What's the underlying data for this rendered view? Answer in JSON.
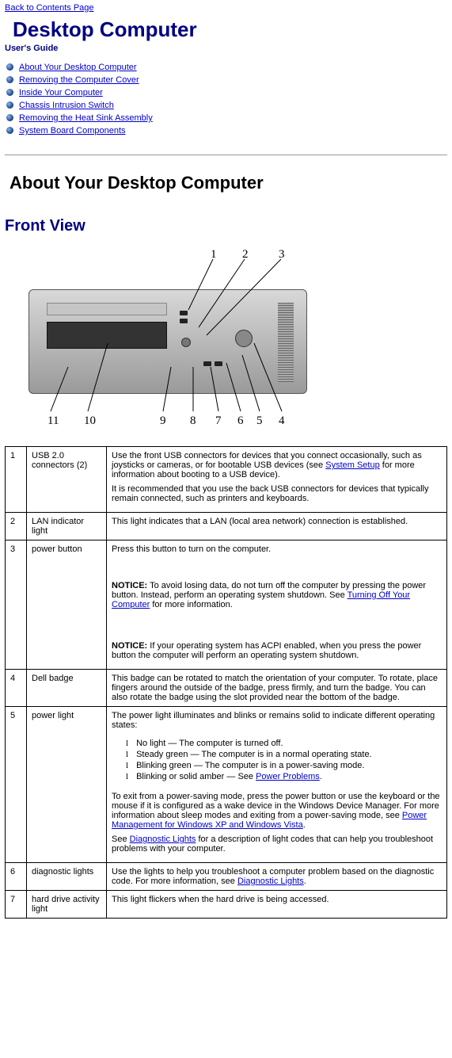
{
  "top_link": "Back to Contents Page",
  "title": "Desktop Computer",
  "guide": "User's Guide",
  "bullets": [
    "About Your Desktop Computer",
    "Removing the Computer Cover",
    "Inside Your Computer",
    "Chassis Intrusion Switch",
    "Removing the Heat Sink Assembly",
    "System Board Components"
  ],
  "section_about": "About Your Desktop Computer",
  "subsection_front": "Front View",
  "callouts_top": {
    "c1": "1",
    "c2": "2",
    "c3": "3"
  },
  "callouts_bottom": {
    "c11": "11",
    "c10": "10",
    "c9": "9",
    "c8": "8",
    "c7": "7",
    "c6": "6",
    "c5": "5",
    "c4": "4"
  },
  "rows": {
    "r1": {
      "num": "1",
      "name": "USB 2.0 connectors (2)",
      "desc_a": "Use the front USB connectors for devices that you connect occasionally, such as joysticks or cameras, or for bootable USB devices (see ",
      "link_a": "System Setup",
      "desc_b": " for more information about booting to a USB device).",
      "desc_c": "It is recommended that you use the back USB connectors for devices that typically remain connected, such as printers and keyboards."
    },
    "r2": {
      "num": "2",
      "name": "LAN indicator light",
      "desc": "This light indicates that a LAN (local area network) connection is established."
    },
    "r3": {
      "num": "3",
      "name": "power button",
      "desc_a": "Press this button to turn on the computer.",
      "notice1_label": "NOTICE:",
      "notice1_a": " To avoid losing data, do not turn off the computer by pressing the power button. Instead, perform an operating system shutdown. See ",
      "notice1_link": "Turning Off Your Computer",
      "notice1_b": " for more information.",
      "notice2_label": "NOTICE:",
      "notice2": " If your operating system has ACPI enabled, when you press the power button the computer will perform an operating system shutdown."
    },
    "r4": {
      "num": "4",
      "name": "Dell badge",
      "desc": "This badge can be rotated to match the orientation of your computer. To rotate, place fingers around the outside of the badge, press firmly, and turn the badge. You can also rotate the badge using the slot provided near the bottom of the badge."
    },
    "r5": {
      "num": "5",
      "name": "power light",
      "intro": "The power light illuminates and blinks or remains solid to indicate different operating states:",
      "li1": "No light — The computer is turned off.",
      "li2": "Steady green — The computer is in a normal operating state.",
      "li3": "Blinking green — The computer is in a power-saving mode.",
      "li4a": "Blinking or solid amber — See ",
      "li4_link": "Power Problems",
      "li4b": ".",
      "mid_a": "To exit from a power-saving mode, press the power button or use the keyboard or the mouse if it is configured as a wake device in the Windows Device Manager. For more information about sleep modes and exiting from a power-saving mode, see ",
      "mid_link": "Power Management for Windows XP and Windows Vista",
      "mid_b": ".",
      "end_a": "See ",
      "end_link": "Diagnostic Lights",
      "end_b": " for a description of light codes that can help you troubleshoot problems with your computer."
    },
    "r6": {
      "num": "6",
      "name": "diagnostic lights",
      "desc_a": "Use the lights to help you troubleshoot a computer problem based on the diagnostic code. For more information, see ",
      "link": "Diagnostic Lights",
      "desc_b": "."
    },
    "r7": {
      "num": "7",
      "name": "hard drive activity light",
      "desc": "This light flickers when the hard drive is being accessed."
    }
  }
}
